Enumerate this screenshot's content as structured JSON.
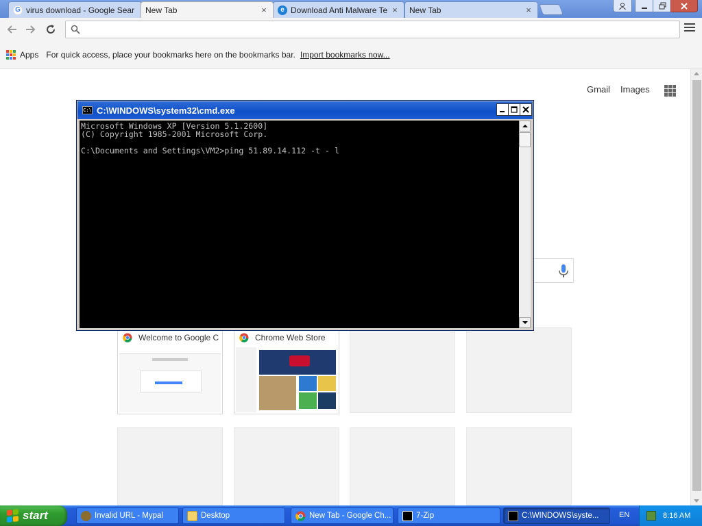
{
  "browser": {
    "tabs": [
      {
        "title": "virus download - Google Sear",
        "favicon": "google-icon",
        "active": false
      },
      {
        "title": "New Tab",
        "favicon": "none",
        "active": true
      },
      {
        "title": "Download Anti Malware Testf",
        "favicon": "ie-icon",
        "active": false
      },
      {
        "title": "New Tab",
        "favicon": "none",
        "active": false
      }
    ],
    "tab_close_glyph": "×",
    "omnibox": {
      "value": "",
      "placeholder": ""
    },
    "bookmarks": {
      "apps_label": "Apps",
      "hint": "For quick access, place your bookmarks here on the bookmarks bar.",
      "import_link": "Import bookmarks now..."
    }
  },
  "newtab": {
    "gmail": "Gmail",
    "images": "Images",
    "tiles": [
      {
        "title": "Welcome to Google C"
      },
      {
        "title": "Chrome Web Store"
      }
    ]
  },
  "cmd": {
    "title": "C:\\WINDOWS\\system32\\cmd.exe",
    "icon_text": "C:\\",
    "lines": [
      "Microsoft Windows XP [Version 5.1.2600]",
      "(C) Copyright 1985-2001 Microsoft Corp.",
      "",
      "C:\\Documents and Settings\\VM2>ping 51.89.14.112 -t - l"
    ]
  },
  "taskbar": {
    "start_label": "start",
    "buttons": [
      {
        "label": "Invalid URL - Mypal",
        "icon": "mypal-icon",
        "active": false
      },
      {
        "label": "Desktop",
        "icon": "folder-icon",
        "active": false
      },
      {
        "label": "New Tab - Google Ch...",
        "icon": "chrome-icon",
        "active": false
      },
      {
        "label": "7-Zip",
        "icon": "7zip-icon",
        "active": false
      },
      {
        "label": "C:\\WINDOWS\\syste...",
        "icon": "cmd-icon",
        "active": true
      }
    ],
    "language": "EN",
    "clock": "8:16 AM"
  },
  "colors": {
    "chrome_tab_bg": "#c9d8f3",
    "xp_taskbar_blue": "#245edb",
    "xp_start_green": "#2f9a2f",
    "cmd_title_blue": "#0f4fc7"
  }
}
